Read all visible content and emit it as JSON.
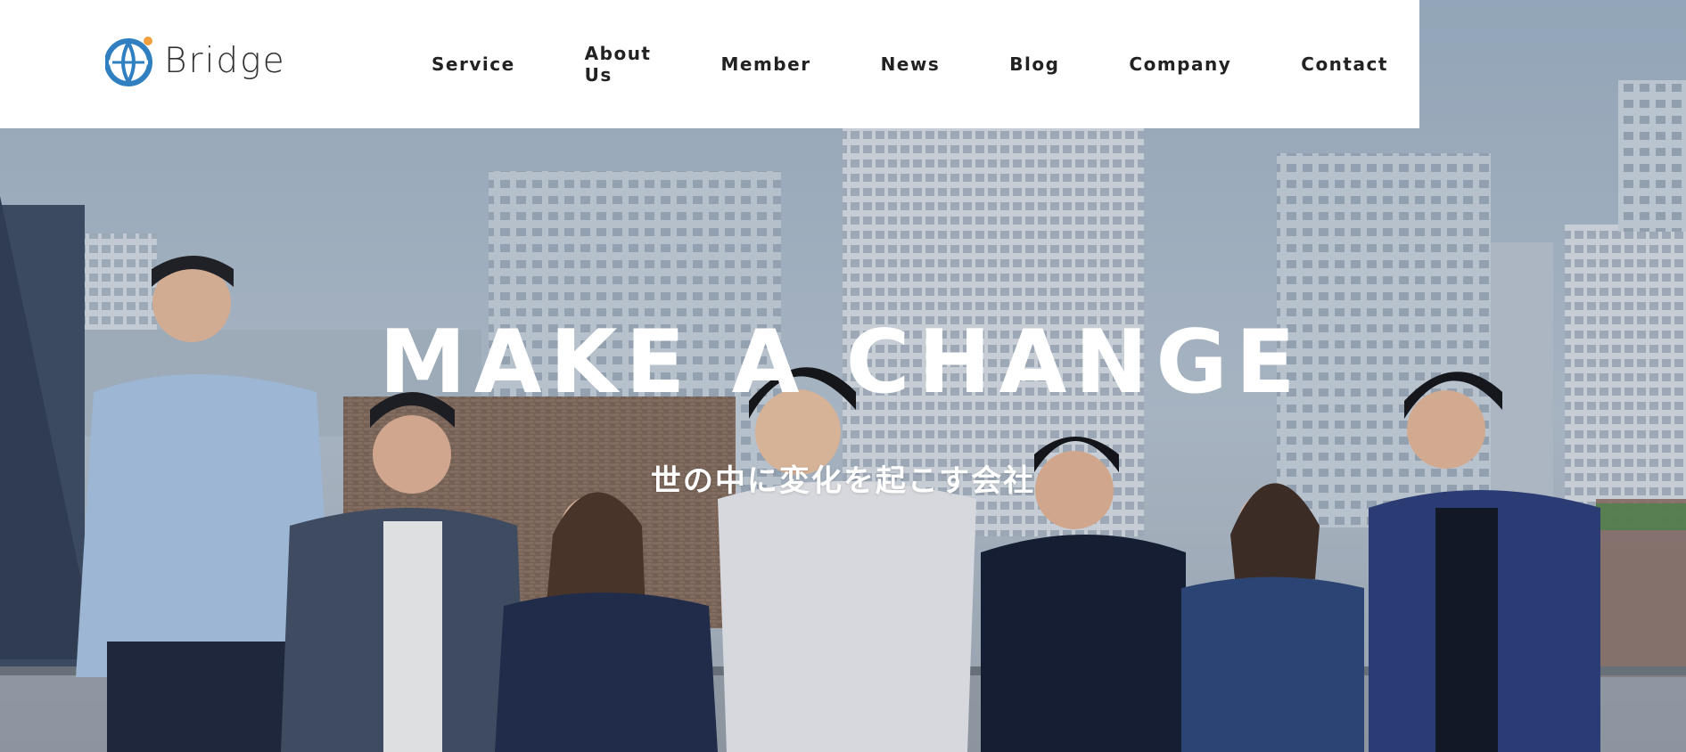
{
  "brand": {
    "name": "Bridge",
    "mark_colors": {
      "globe": "#2f7fc1",
      "dot": "#f2a03d"
    }
  },
  "nav": {
    "items": [
      {
        "label": "Service"
      },
      {
        "label": "About Us"
      },
      {
        "label": "Member"
      },
      {
        "label": "News"
      },
      {
        "label": "Blog"
      },
      {
        "label": "Company"
      },
      {
        "label": "Contact"
      }
    ]
  },
  "hero": {
    "title": "MAKE A CHANGE",
    "subtitle": "世の中に変化を起こす会社"
  },
  "colors": {
    "header_bg": "#ffffff",
    "nav_text": "#222222",
    "hero_text": "#ffffff"
  }
}
